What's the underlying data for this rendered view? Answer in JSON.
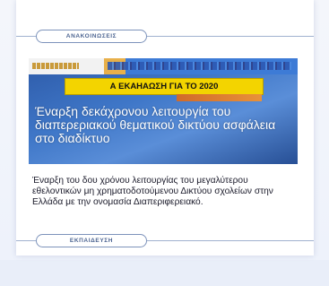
{
  "section": {
    "announcements_label": "ΑΝΑΚΟΙΝΩΣΕΙΣ"
  },
  "article": {
    "banner": "Α ΕΚΑΗΑΩΣΗ ΓΙΑ ΤΟ 2020",
    "image_headline": "Έναρξη δεκάχρονου λειτουργία του διαπερεριακού θεματικού δικτύου ασφάλεια στο διαδίκτυο",
    "teaser": "Έναρξη του δου χρόνου λειτουργίας του μεγαλύτερου εθελοντικών μη χρηματοδοτούμενου Δικτύου σχολείων στην Ελλάδα με την ονομασία Διαπεριφερειακό.",
    "more_label": "ΕΚΠΑΙΔΕΥΣΗ"
  }
}
